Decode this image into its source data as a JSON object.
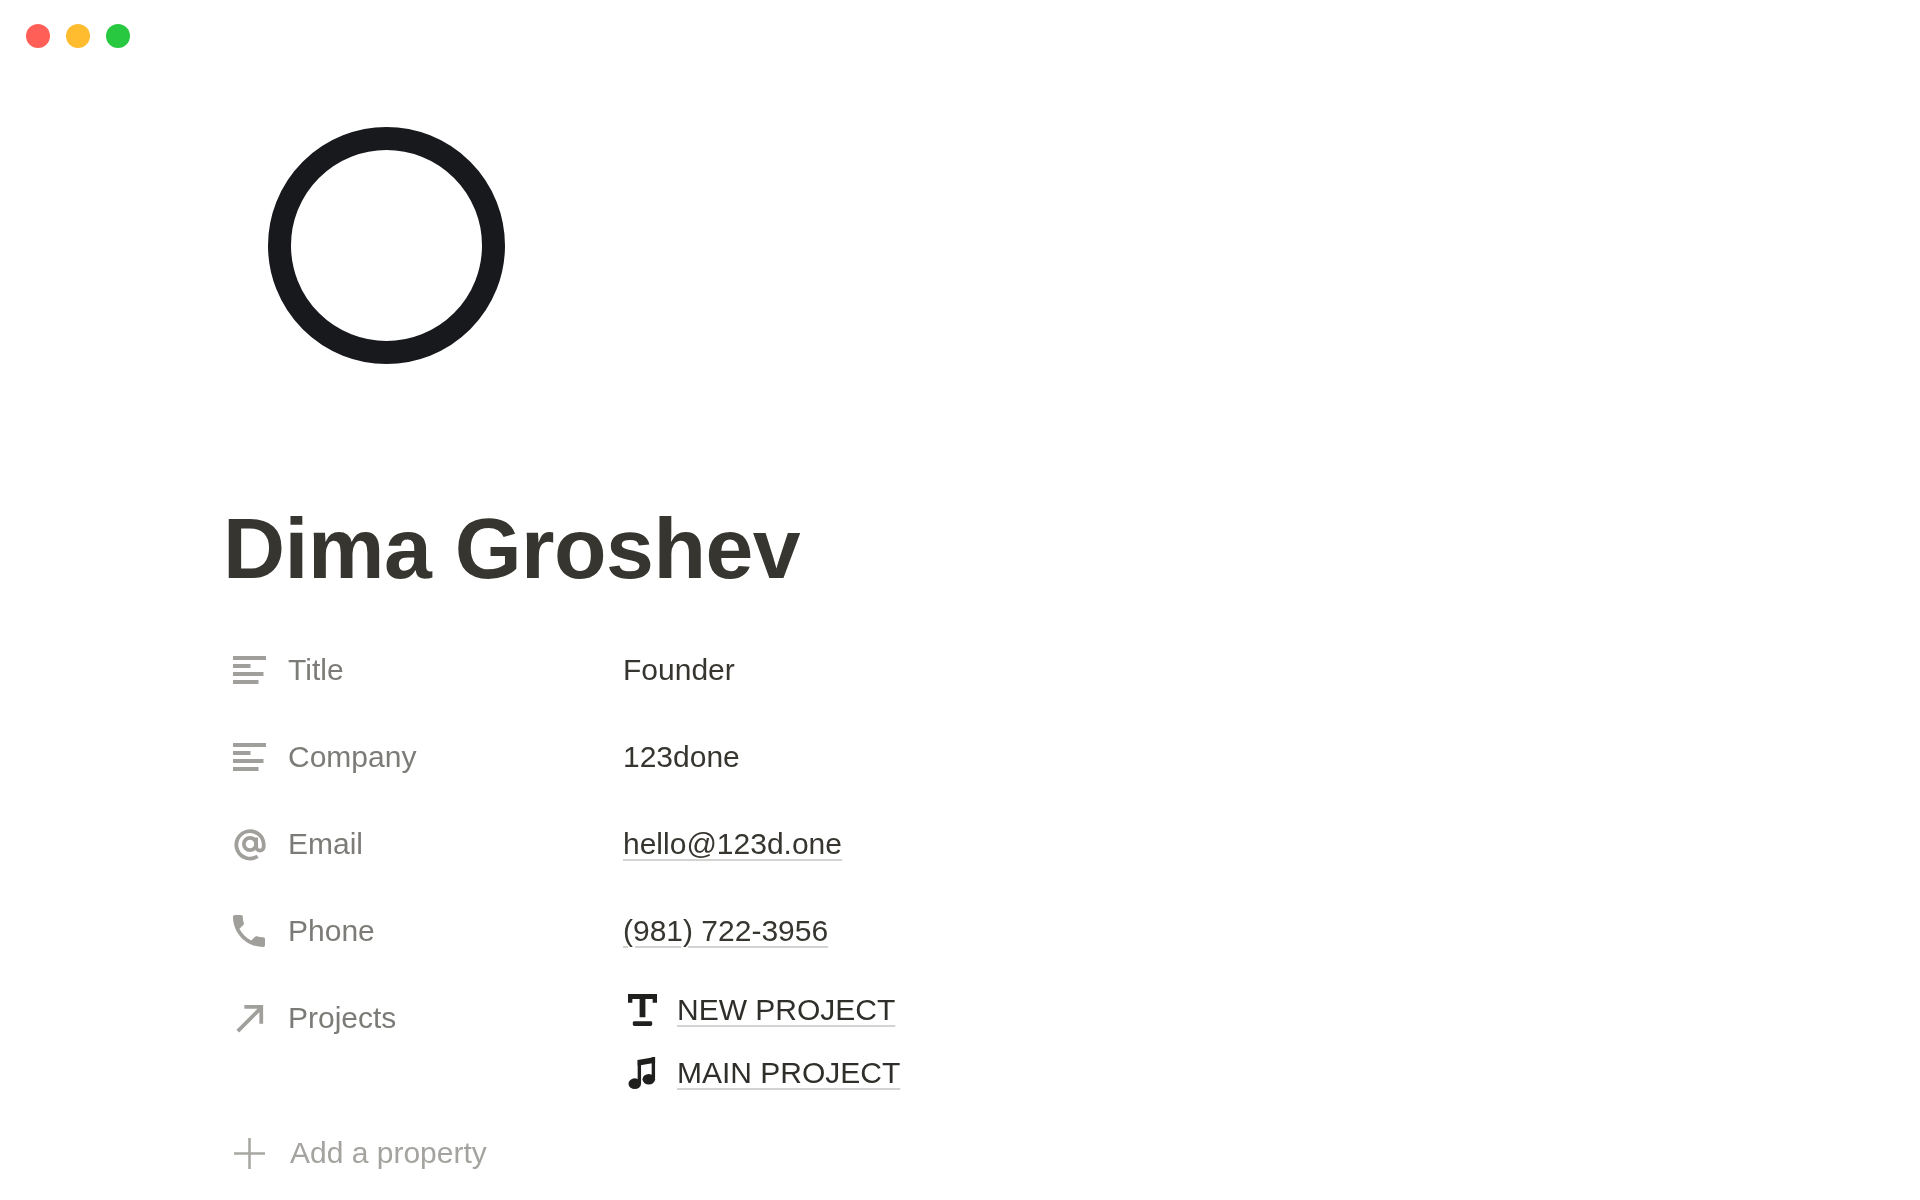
{
  "window": {
    "controls": [
      {
        "color": "#ff5f57"
      },
      {
        "color": "#febc2e"
      },
      {
        "color": "#28c840"
      }
    ]
  },
  "page": {
    "title": "Dima Groshev"
  },
  "properties": [
    {
      "kind": "text",
      "label": "Title",
      "value": "Founder"
    },
    {
      "kind": "text",
      "label": "Company",
      "value": "123done"
    },
    {
      "kind": "email",
      "label": "Email",
      "value": "hello@123d.one"
    },
    {
      "kind": "phone",
      "label": "Phone",
      "value": "(981) 722-3956"
    },
    {
      "kind": "relation",
      "label": "Projects",
      "items": [
        {
          "title": "NEW PROJECT"
        },
        {
          "title": "MAIN PROJECT"
        }
      ]
    }
  ],
  "add_property": {
    "label": "Add a property"
  }
}
